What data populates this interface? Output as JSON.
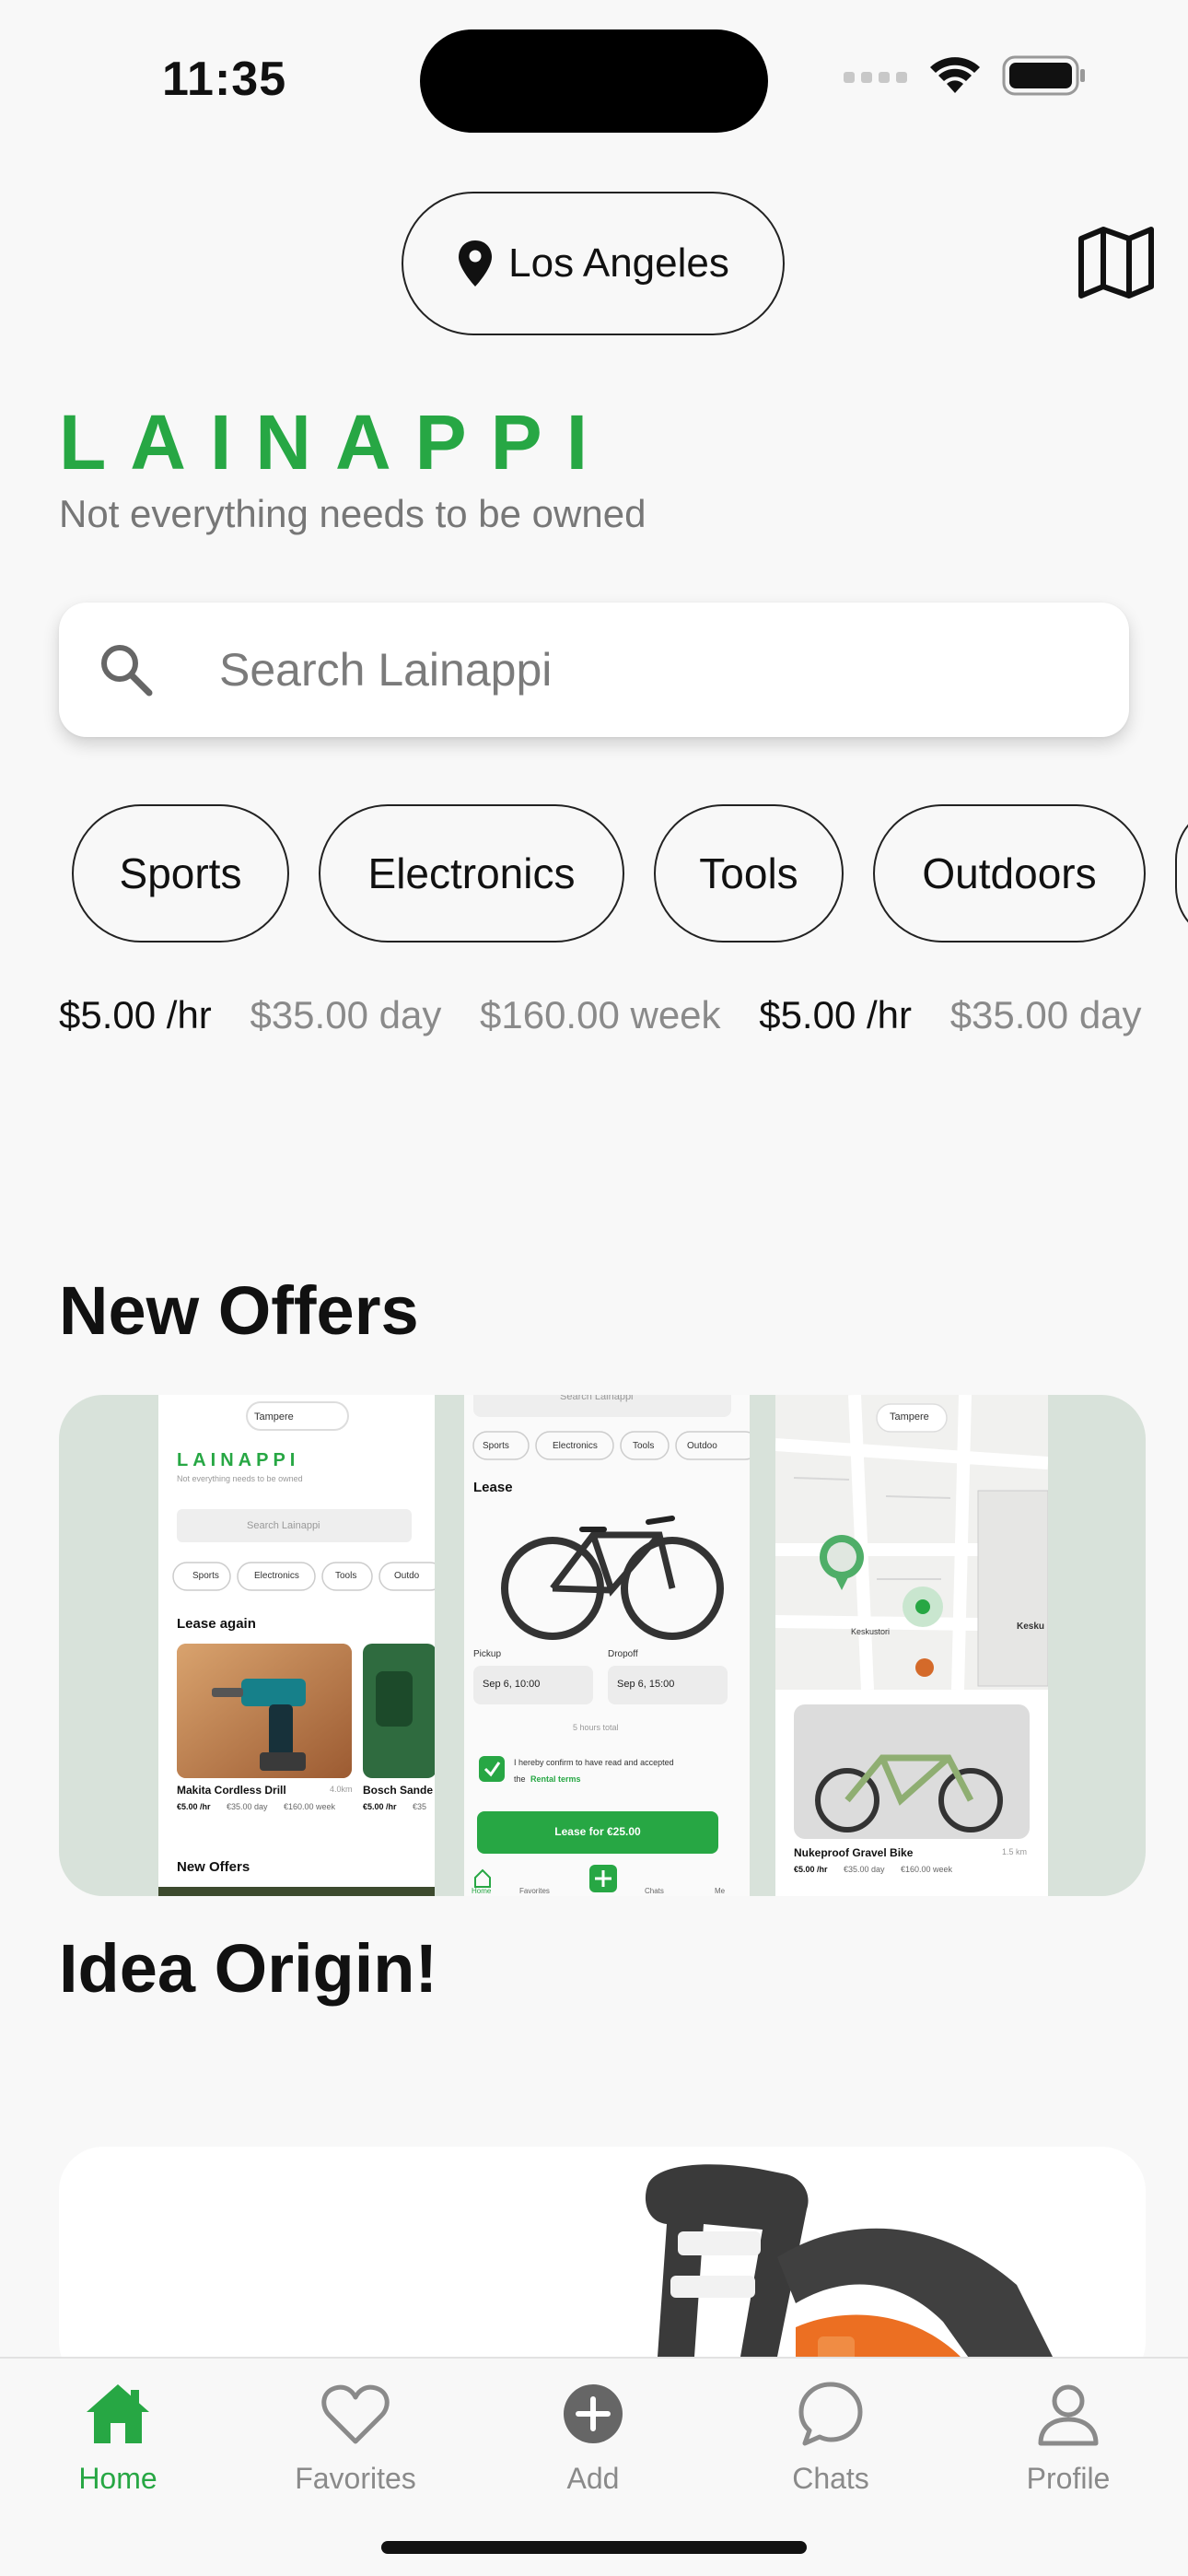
{
  "status": {
    "time": "11:35"
  },
  "location": {
    "label": "Los Angeles"
  },
  "brand": {
    "title": "LAINAPPI",
    "tagline": "Not everything needs to be owned"
  },
  "search": {
    "placeholder": "Search Lainappi"
  },
  "categories": [
    "Sports",
    "Electronics",
    "Tools",
    "Outdoors"
  ],
  "prices": [
    {
      "hour": "$5.00 /hr",
      "day": "$35.00 day",
      "week": "$160.00 week"
    },
    {
      "hour": "$5.00 /hr",
      "day": "$35.00 day"
    }
  ],
  "sections": {
    "new_offers": "New Offers",
    "idea_origin": "Idea Origin!"
  },
  "banner": {
    "shot1": {
      "location": "Tampere",
      "brand": "LAINAPPI",
      "tagline": "Not everything needs to be owned",
      "search": "Search Lainappi",
      "chips": [
        "Sports",
        "Electronics",
        "Tools",
        "Outdo"
      ],
      "heading": "Lease again",
      "item1_name": "Makita Cordless Drill",
      "item1_dist": "4.0km",
      "item1_price": "€5.00 /hr",
      "item1_day": "€35.00 day",
      "item1_week": "€160.00 week",
      "item2_name": "Bosch Sande",
      "item2_price": "€5.00 /hr",
      "item2_day": "€35",
      "heading2": "New Offers"
    },
    "shot2": {
      "search": "Search Lainappi",
      "chips": [
        "Sports",
        "Electronics",
        "Tools",
        "Outdoo"
      ],
      "heading": "Lease",
      "pickup_label": "Pickup",
      "pickup_value": "Sep 6, 10:00",
      "dropoff_label": "Dropoff",
      "dropoff_value": "Sep 6, 15:00",
      "total": "5 hours total",
      "terms": "I hereby confirm to have read and accepted",
      "terms_the": "the",
      "terms_link": "Rental terms",
      "cta": "Lease for €25.00",
      "tabs": [
        "Home",
        "Favorites",
        "Chats",
        "Me"
      ]
    },
    "shot3": {
      "location": "Tampere",
      "stop1": "Keskustori",
      "stop2": "Kesku",
      "item_name": "Nukeproof Gravel Bike",
      "item_dist": "1.5 km",
      "item_price": "€5.00 /hr",
      "item_day": "€35.00 day",
      "item_week": "€160.00 week"
    }
  },
  "tabs": [
    {
      "label": "Home",
      "icon": "home-icon",
      "active": true
    },
    {
      "label": "Favorites",
      "icon": "heart-icon",
      "active": false
    },
    {
      "label": "Add",
      "icon": "plus-circle-icon",
      "active": false
    },
    {
      "label": "Chats",
      "icon": "chat-bubble-icon",
      "active": false
    },
    {
      "label": "Profile",
      "icon": "person-icon",
      "active": false
    }
  ],
  "colors": {
    "accent": "#27a744",
    "muted": "#8a8a8a",
    "banner_bg": "#d8e2da"
  }
}
